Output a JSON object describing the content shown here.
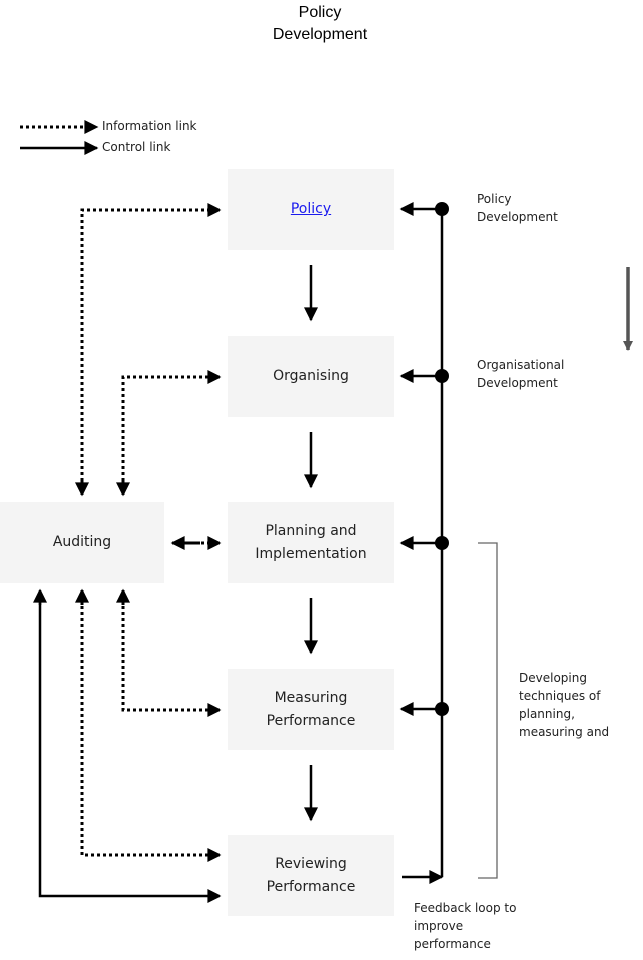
{
  "title": "Policy Development",
  "title_lines": [
    "Policy",
    "Development"
  ],
  "legend": {
    "information_link": "Information link",
    "control_link": "Control link"
  },
  "boxes": {
    "policy": {
      "label": "Policy",
      "is_link": true
    },
    "organising": {
      "label": "Organising"
    },
    "planning": {
      "line1": "Planning and",
      "line2": "Implementation"
    },
    "measuring": {
      "line1": "Measuring",
      "line2": "Performance"
    },
    "reviewing": {
      "line1": "Reviewing",
      "line2": "Performance"
    },
    "auditing": {
      "label": "Auditing"
    }
  },
  "side_labels": {
    "policy_dev": {
      "line1": "Policy",
      "line2": "Development"
    },
    "org_dev": {
      "line1": "Organisational",
      "line2": "Development"
    },
    "techniques": {
      "line1": "Developing",
      "line2": "techniques of",
      "line3": "planning,",
      "line4": "measuring and"
    },
    "feedback": {
      "line1": "Feedback loop to",
      "line2": "improve",
      "line3": "performance"
    }
  },
  "colors": {
    "link": "#1a1aee",
    "box_fill": "#f4f4f4",
    "line": "#000000",
    "bracket": "#666666",
    "side_arrow": "#555555"
  }
}
